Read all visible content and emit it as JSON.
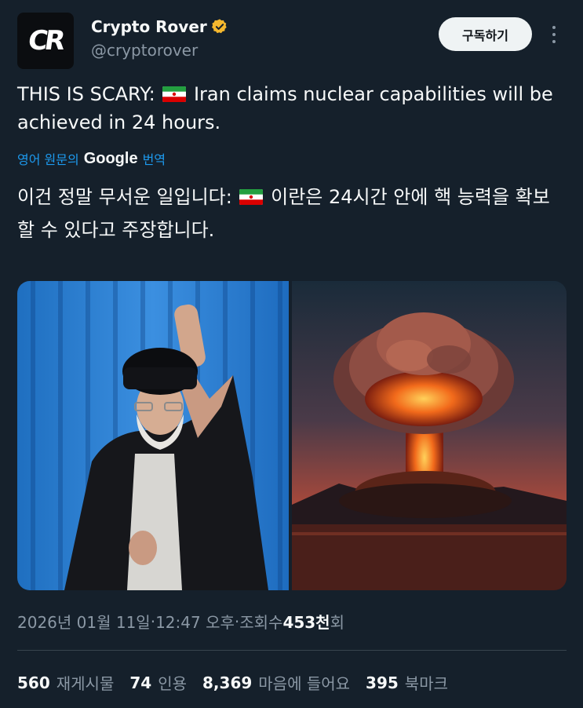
{
  "author": {
    "avatar_text": "CR",
    "display_name": "Crypto Rover",
    "handle": "@cryptorover",
    "verified_color": "#f5b82e"
  },
  "header": {
    "subscribe_label": "구독하기"
  },
  "tweet": {
    "text_part1": "THIS IS SCARY: ",
    "text_part2": " Iran claims nuclear capabilities will be achieved in 24 hours.",
    "translate_prefix": "영어 원문의",
    "translate_brand": "Google",
    "translate_suffix": "번역",
    "translated_part1": "이건 정말 무서운 일입니다: ",
    "translated_part2": " 이란은 24시간 안에 핵 능력을 확보할 수 있다고 주장합니다."
  },
  "meta": {
    "date": "2026년 01월 11일",
    "sep1": " · ",
    "time": "12:47 오후",
    "sep2": " · ",
    "views_label": "조회수 ",
    "views_value": "453천",
    "views_suffix": "회"
  },
  "stats": [
    {
      "value": "560",
      "label": "재게시물"
    },
    {
      "value": "74",
      "label": "인용"
    },
    {
      "value": "8,369",
      "label": "마음에 들어요"
    },
    {
      "value": "395",
      "label": "북마크"
    }
  ],
  "colors": {
    "background": "#15202b",
    "link": "#1d9bf0",
    "muted": "#8b98a5"
  }
}
